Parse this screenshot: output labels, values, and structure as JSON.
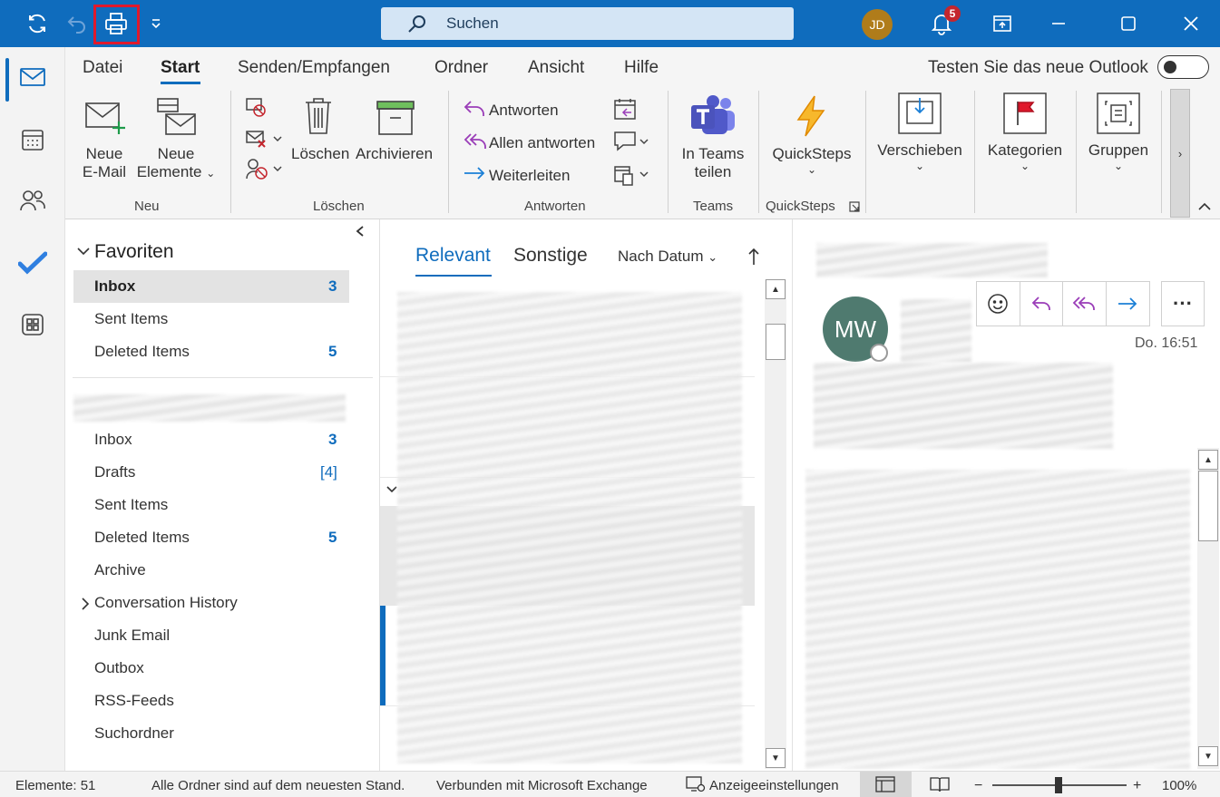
{
  "titlebar": {
    "search_label": "Suchen",
    "user_initials": "JD",
    "notification_count": "5"
  },
  "ribbon": {
    "tabs": [
      "Datei",
      "Start",
      "Senden/Empfangen",
      "Ordner",
      "Ansicht",
      "Hilfe"
    ],
    "try_new_outlook": "Testen Sie das neue Outlook",
    "new_email_line1": "Neue",
    "new_email_line2": "E-Mail",
    "new_items_line1": "Neue",
    "new_items_line2": "Elemente",
    "delete": "Löschen",
    "archive": "Archivieren",
    "reply": "Antworten",
    "reply_all": "Allen antworten",
    "forward": "Weiterleiten",
    "teams_line1": "In Teams",
    "teams_line2": "teilen",
    "quicksteps": "QuickSteps",
    "move": "Verschieben",
    "categories": "Kategorien",
    "groups": "Gruppen",
    "groups_labels": {
      "new": "Neu",
      "delete": "Löschen",
      "respond": "Antworten",
      "teams": "Teams",
      "quicksteps": "QuickSteps"
    }
  },
  "folders": {
    "favorites_header": "Favoriten",
    "favorites": [
      {
        "name": "Inbox",
        "count": "3"
      },
      {
        "name": "Sent Items",
        "count": ""
      },
      {
        "name": "Deleted Items",
        "count": "5"
      }
    ],
    "account": [
      {
        "name": "Inbox",
        "count": "3"
      },
      {
        "name": "Drafts",
        "count": "[4]"
      },
      {
        "name": "Sent Items",
        "count": ""
      },
      {
        "name": "Deleted Items",
        "count": "5"
      },
      {
        "name": "Archive",
        "count": ""
      },
      {
        "name": "Conversation History",
        "count": ""
      },
      {
        "name": "Junk Email",
        "count": ""
      },
      {
        "name": "Outbox",
        "count": ""
      },
      {
        "name": "RSS-Feeds",
        "count": ""
      },
      {
        "name": "Suchordner",
        "count": ""
      }
    ]
  },
  "messagelist": {
    "tab_focused": "Relevant",
    "tab_other": "Sonstige",
    "sort_label": "Nach Datum"
  },
  "reading": {
    "sender_initials": "MW",
    "time": "Do. 16:51"
  },
  "statusbar": {
    "items_count": "Elemente: 51",
    "sync_status": "Alle Ordner sind auf dem neuesten Stand.",
    "connection": "Verbunden mit Microsoft Exchange",
    "display_settings": "Anzeigeeinstellungen",
    "zoom": "100%"
  },
  "colors": {
    "accent": "#0f6cbd",
    "highlight_box": "#e0192c"
  }
}
